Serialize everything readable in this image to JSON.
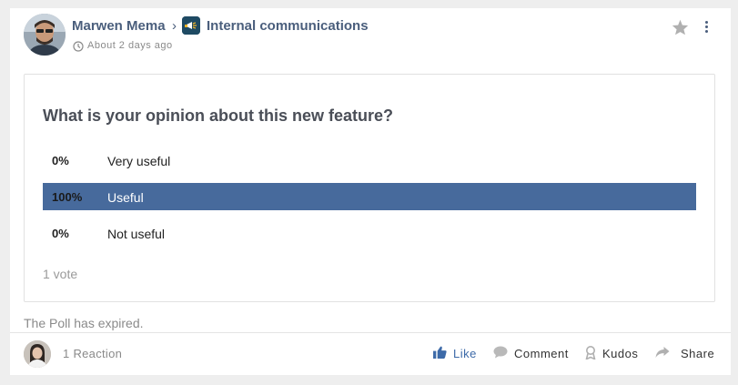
{
  "post": {
    "author": "Marwen Mema",
    "breadcrumb_separator": "›",
    "space": "Internal communications",
    "time": "About 2 days ago"
  },
  "poll": {
    "question": "What is your opinion about this new feature?",
    "options": [
      {
        "percent": "0%",
        "label": "Very useful",
        "selected": false,
        "share": 0
      },
      {
        "percent": "100%",
        "label": "Useful",
        "selected": true,
        "share": 1.0
      },
      {
        "percent": "0%",
        "label": "Not useful",
        "selected": false,
        "share": 0
      }
    ],
    "votes": "1 vote",
    "status": "The Poll has expired."
  },
  "reactions": {
    "count": "1 Reaction"
  },
  "actions": {
    "like": "Like",
    "comment": "Comment",
    "kudos": "Kudos",
    "share": "Share"
  },
  "colors": {
    "accent": "#476a9c",
    "link": "#4a5e7c",
    "like_active": "#3d6aa8",
    "muted": "#8a8a8a"
  },
  "icons": [
    "clock-icon",
    "star-icon",
    "more-vertical-icon",
    "megaphone-icon",
    "thumbs-up-icon",
    "comment-icon",
    "kudos-icon",
    "share-icon"
  ]
}
